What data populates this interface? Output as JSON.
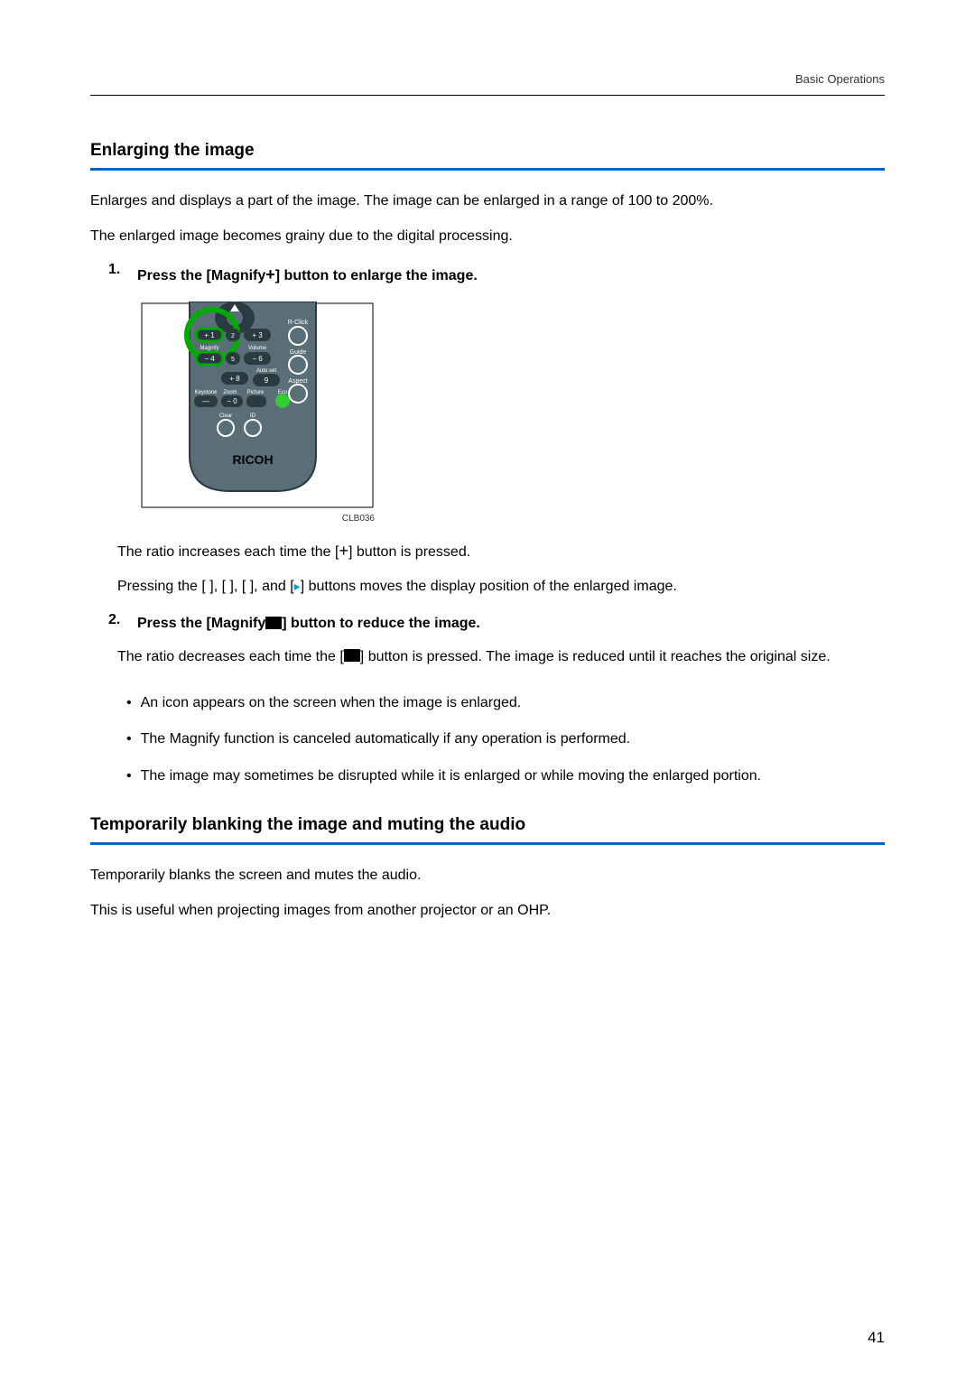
{
  "header": {
    "category": "Basic Operations"
  },
  "section1": {
    "heading": "Enlarging the image",
    "para1": "Enlarges and displays a part of the image. The image can be enlarged in a range of 100 to 200%.",
    "para2": "The enlarged image becomes grainy due to the digital processing.",
    "steps": [
      {
        "num": "1.",
        "title_before": "Press the [Magnify",
        "title_plus": "+",
        "title_after": "] button to enlarge the image.",
        "figure_caption": "CLB036",
        "desc1_before": "The ratio increases each time the [",
        "desc1_plus": "+",
        "desc1_after": "] button is pressed.",
        "desc2_before": "Pressing the [   ], [   ], [   ], and [",
        "desc2_arrow": "▸",
        "desc2_after": "] buttons moves the display position of the enlarged image."
      },
      {
        "num": "2.",
        "title_before": "Press the [Magnify",
        "title_after": "] button to reduce the image.",
        "desc_before": "The ratio decreases each time the [",
        "desc_after": "] button is pressed. The image is reduced until it reaches the original size."
      }
    ],
    "bullets": [
      "An icon appears on the screen when the image is enlarged.",
      "The Magnify function is canceled automatically if any operation is performed.",
      "The image may sometimes be disrupted while it is enlarged or while moving the enlarged portion."
    ]
  },
  "section2": {
    "heading": "Temporarily blanking the image and muting the audio",
    "para1": "Temporarily blanks the screen and mutes the audio.",
    "para2": "This is useful when projecting images from another projector or an OHP."
  },
  "remote": {
    "brand": "RICOH",
    "labels": {
      "rclick": "R-Click",
      "guide": "Guide",
      "aspect": "Aspect",
      "eco": "Eco",
      "magnify": "Magnify",
      "volume": "Volume",
      "autoset": "Auto set",
      "keystone": "Keystone",
      "zoom": "Zoom",
      "picture": "Picture",
      "clear": "Clear",
      "id": "ID"
    }
  },
  "page_number": "41"
}
